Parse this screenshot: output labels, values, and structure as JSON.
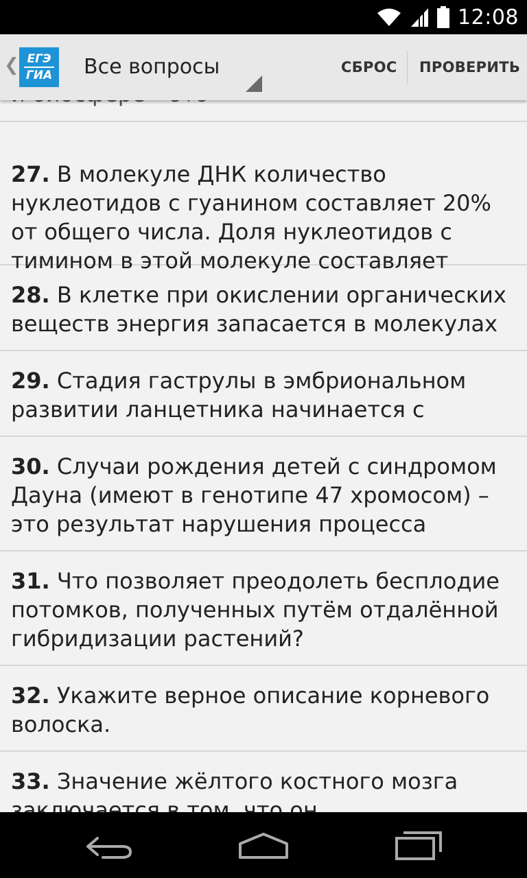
{
  "status_bar": {
    "time": "12:08",
    "icons": [
      "wifi-icon",
      "signal-icon",
      "battery-icon"
    ]
  },
  "action_bar": {
    "logo": {
      "line1": "ЕГЭ",
      "line2": "ГИА",
      "color": "#1e93d6"
    },
    "spinner_value": "Все вопросы",
    "reset_label": "СБРОС",
    "check_label": "ПРОВЕРИТЬ"
  },
  "questions": [
    {
      "number": "",
      "text": "и биосфере – это"
    },
    {
      "number": "27.",
      "text": "В молекуле ДНК количество нуклеотидов с гуанином составляет 20% от общего числа. Доля нуклеотидов с тимином в этой молекуле составляет"
    },
    {
      "number": "28.",
      "text": "В клетке при окислении органических веществ энергия запасается в молекулах"
    },
    {
      "number": "29.",
      "text": "Стадия гаструлы в эмбриональном развитии ланцетника начинается с"
    },
    {
      "number": "30.",
      "text": "Случаи рождения детей с синдромом Дауна (имеют в генотипе 47 хромосом) – это результат нарушения процесса"
    },
    {
      "number": "31.",
      "text": "Что позволяет преодолеть бесплодие потомков, полученных путём отдалённой гибридизации растений?"
    },
    {
      "number": "32.",
      "text": "Укажите верное описание корневого волоска."
    },
    {
      "number": "33.",
      "text": "Значение жёлтого костного мозга заключается в том, что он"
    }
  ],
  "nav_bar": {
    "buttons": [
      "back-icon",
      "home-icon",
      "recent-apps-icon"
    ]
  }
}
